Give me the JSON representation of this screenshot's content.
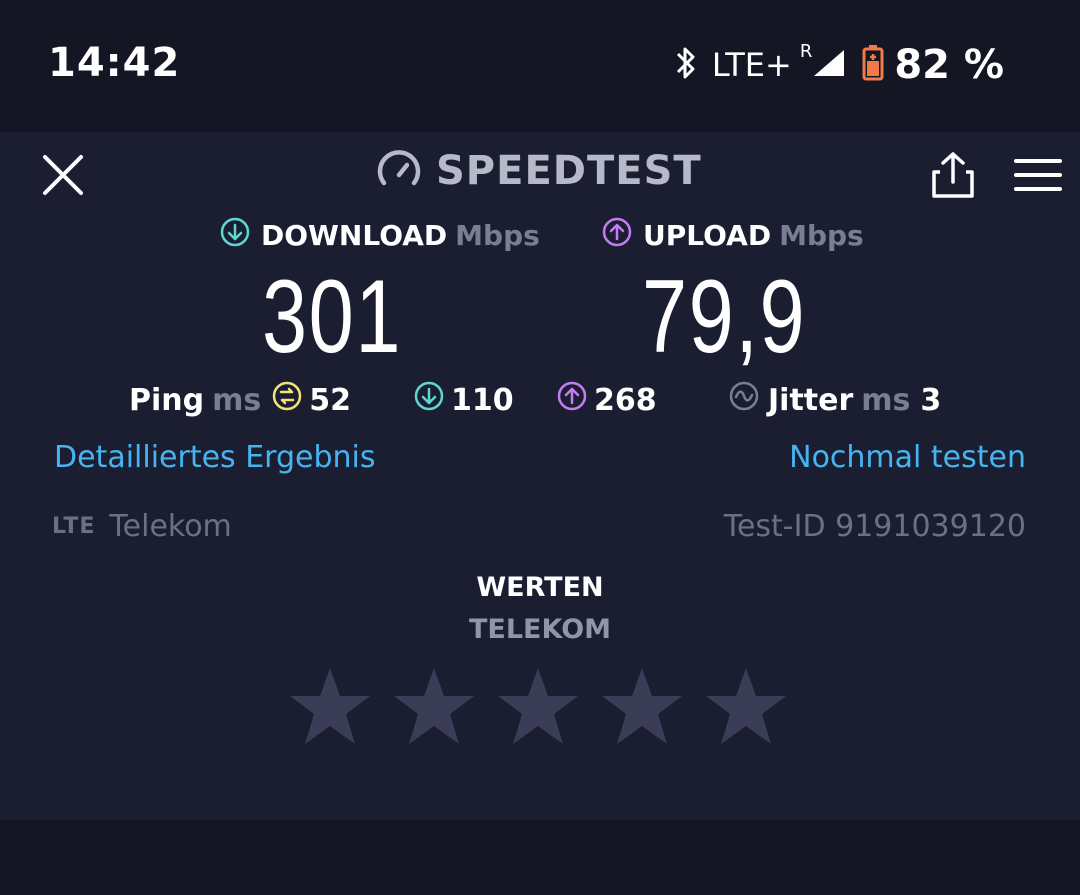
{
  "status_bar": {
    "time": "14:42",
    "network": "LTE+",
    "roaming_indicator": "R",
    "battery": "82 %",
    "icons": [
      "bluetooth-icon",
      "signal-icon",
      "battery-icon"
    ]
  },
  "header": {
    "title": "SPEEDTEST",
    "icons": [
      "close-icon",
      "speedometer-icon",
      "share-icon",
      "menu-icon"
    ]
  },
  "download": {
    "label": "DOWNLOAD",
    "unit": "Mbps",
    "value": "301"
  },
  "upload": {
    "label": "UPLOAD",
    "unit": "Mbps",
    "value": "79,9"
  },
  "ping": {
    "label": "Ping",
    "unit": "ms",
    "idle": "52",
    "download": "110",
    "upload": "268"
  },
  "jitter": {
    "label": "Jitter",
    "unit": "ms",
    "value": "3"
  },
  "links": {
    "details": "Detailliertes Ergebnis",
    "retest": "Nochmal testen"
  },
  "connection": {
    "type": "LTE",
    "provider": "Telekom",
    "test_id": "Test-ID 9191039120"
  },
  "rating": {
    "title": "WERTEN",
    "subject": "TELEKOM",
    "max_stars": 5,
    "selected": 0
  },
  "colors": {
    "download": "#5fd6d0",
    "upload": "#c47cf5",
    "ping": "#f3e27a",
    "link": "#46b4f0",
    "battery": "#f07a4a"
  }
}
